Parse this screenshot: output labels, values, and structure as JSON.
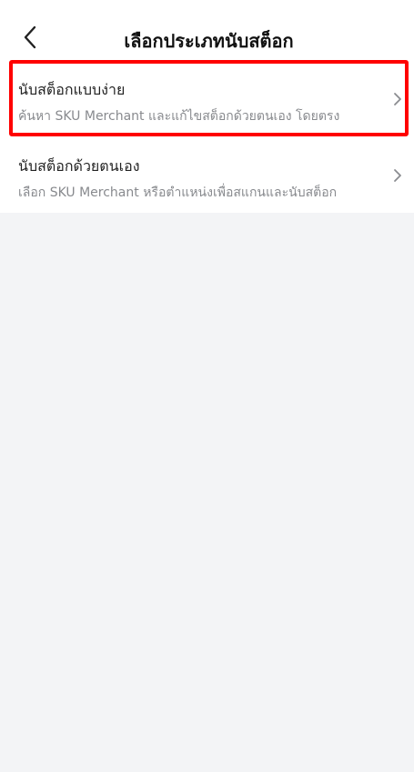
{
  "header": {
    "title": "เลือกประเภทนับสต็อก",
    "back_icon": "chevron-left-icon"
  },
  "options": [
    {
      "title": "นับสต็อกแบบง่าย",
      "subtitle": "ค้นหา SKU Merchant และแก้ไขสต็อกด้วยตนเอง โดยตรง",
      "highlighted": true
    },
    {
      "title": "นับสต็อกด้วยตนเอง",
      "subtitle": "เลือก SKU Merchant หรือตำแหน่งเพื่อสแกนและนับสต็อก",
      "highlighted": false
    }
  ],
  "colors": {
    "highlight_border": "#ff0000",
    "background": "#f3f4f6",
    "subtitle_text": "#888a8e"
  }
}
